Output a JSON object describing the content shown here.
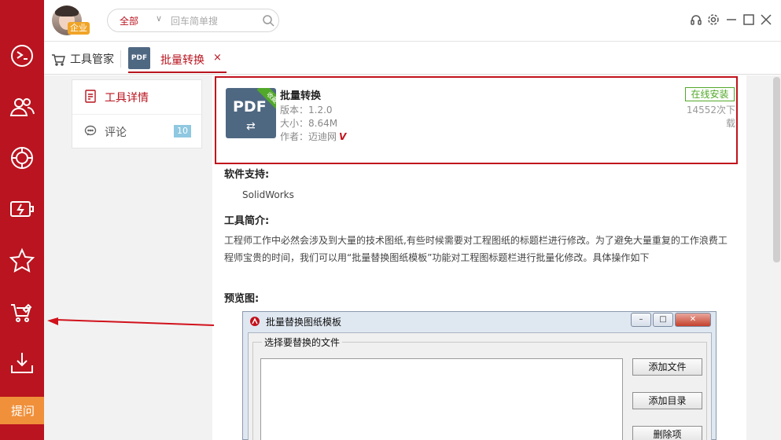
{
  "colors": {
    "accent": "#b9141f",
    "ask_button": "#f0903a",
    "install_green": "#52a829",
    "pdf_icon": "#4f6882"
  },
  "sidebar": {
    "items": [
      {
        "icon": "design-icon"
      },
      {
        "icon": "users-icon"
      },
      {
        "icon": "gear-wheel-icon"
      },
      {
        "icon": "battery-icon"
      },
      {
        "icon": "star-icon"
      },
      {
        "icon": "toolbox-icon"
      },
      {
        "icon": "download-icon"
      }
    ],
    "ask_label": "提问"
  },
  "header": {
    "user_badge": "企业",
    "search": {
      "category": "全部",
      "placeholder": "回车简单搜"
    }
  },
  "tabs": [
    {
      "label": "工具管家"
    },
    {
      "label": "批量转换",
      "close": "×",
      "icon_text": "PDF"
    }
  ],
  "left_menu": {
    "items": [
      {
        "label": "工具详情",
        "active": true
      },
      {
        "label": "评论",
        "count": "10"
      }
    ]
  },
  "tool": {
    "icon_text": "PDF",
    "ribbon": "收藏",
    "name": "批量转换",
    "version": "版本：1.2.0",
    "size": "大小：8.64M",
    "author": "作者：迈迪网",
    "vip_mark": "V",
    "install_label": "在线安装",
    "downloads": "14552次下载"
  },
  "detail": {
    "support_title": "软件支持:",
    "support_value": "SolidWorks",
    "intro_title": "工具简介:",
    "intro_line1": "工程师工作中必然会涉及到大量的技术图纸,有些时候需要对工程图纸的标题栏进行修改。为了避免大量重复的工作浪费工",
    "intro_line2": "程师宝贵的时间，我们可以用“批量替换图纸模板”功能对工程图标题栏进行批量化修改。具体操作如下",
    "preview_title": "预览图:"
  },
  "preview_dialog": {
    "title": "批量替换图纸模板",
    "group_label": "选择要替换的文件",
    "buttons": [
      "添加文件",
      "添加目录",
      "删除项"
    ]
  }
}
